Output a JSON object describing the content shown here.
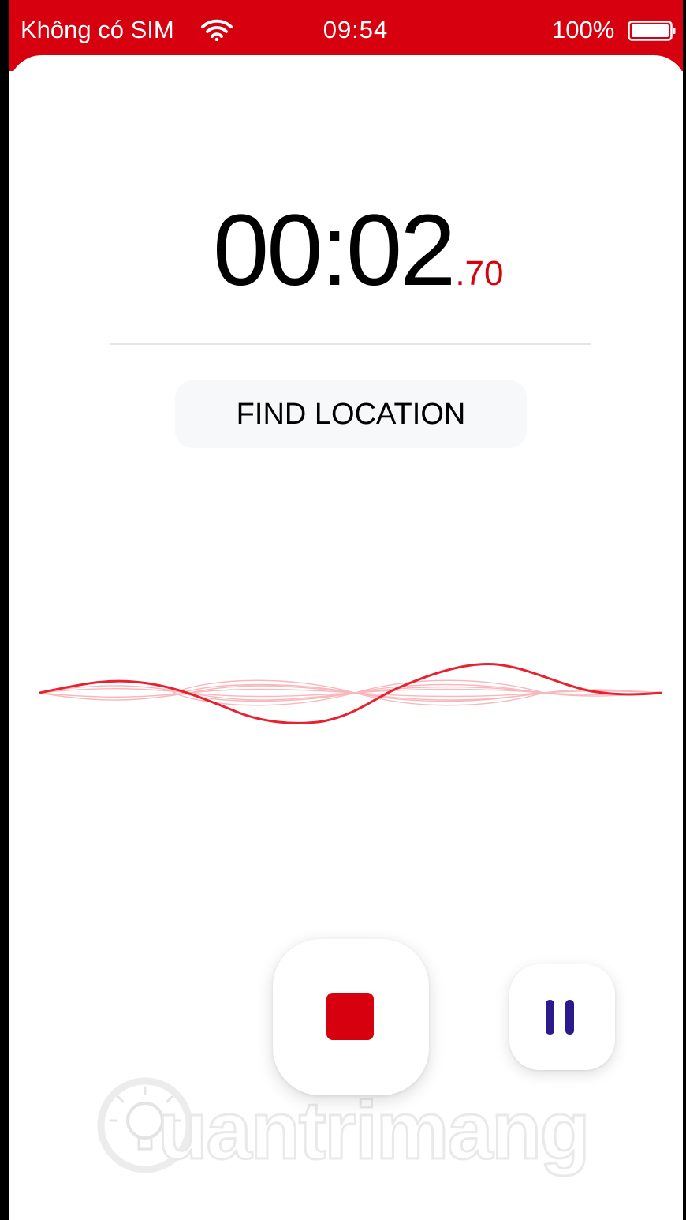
{
  "status_bar": {
    "carrier": "Không có SIM",
    "wifi_icon": "wifi-icon",
    "time": "09:54",
    "battery_percent": "100%",
    "battery_icon": "battery-full-icon",
    "background_color": "#d7000f"
  },
  "recorder": {
    "timer_main": "00:02",
    "timer_fraction": ".70",
    "timer_fraction_color": "#d7000f",
    "find_location_label": "FIND LOCATION",
    "waveform_color": "#e8212f",
    "stop_icon": "stop-icon",
    "stop_color": "#d7000f",
    "pause_icon": "pause-icon",
    "pause_color": "#2a1a8c"
  },
  "watermark": {
    "text": "uantrimang",
    "logo": "lightbulb-logo"
  }
}
